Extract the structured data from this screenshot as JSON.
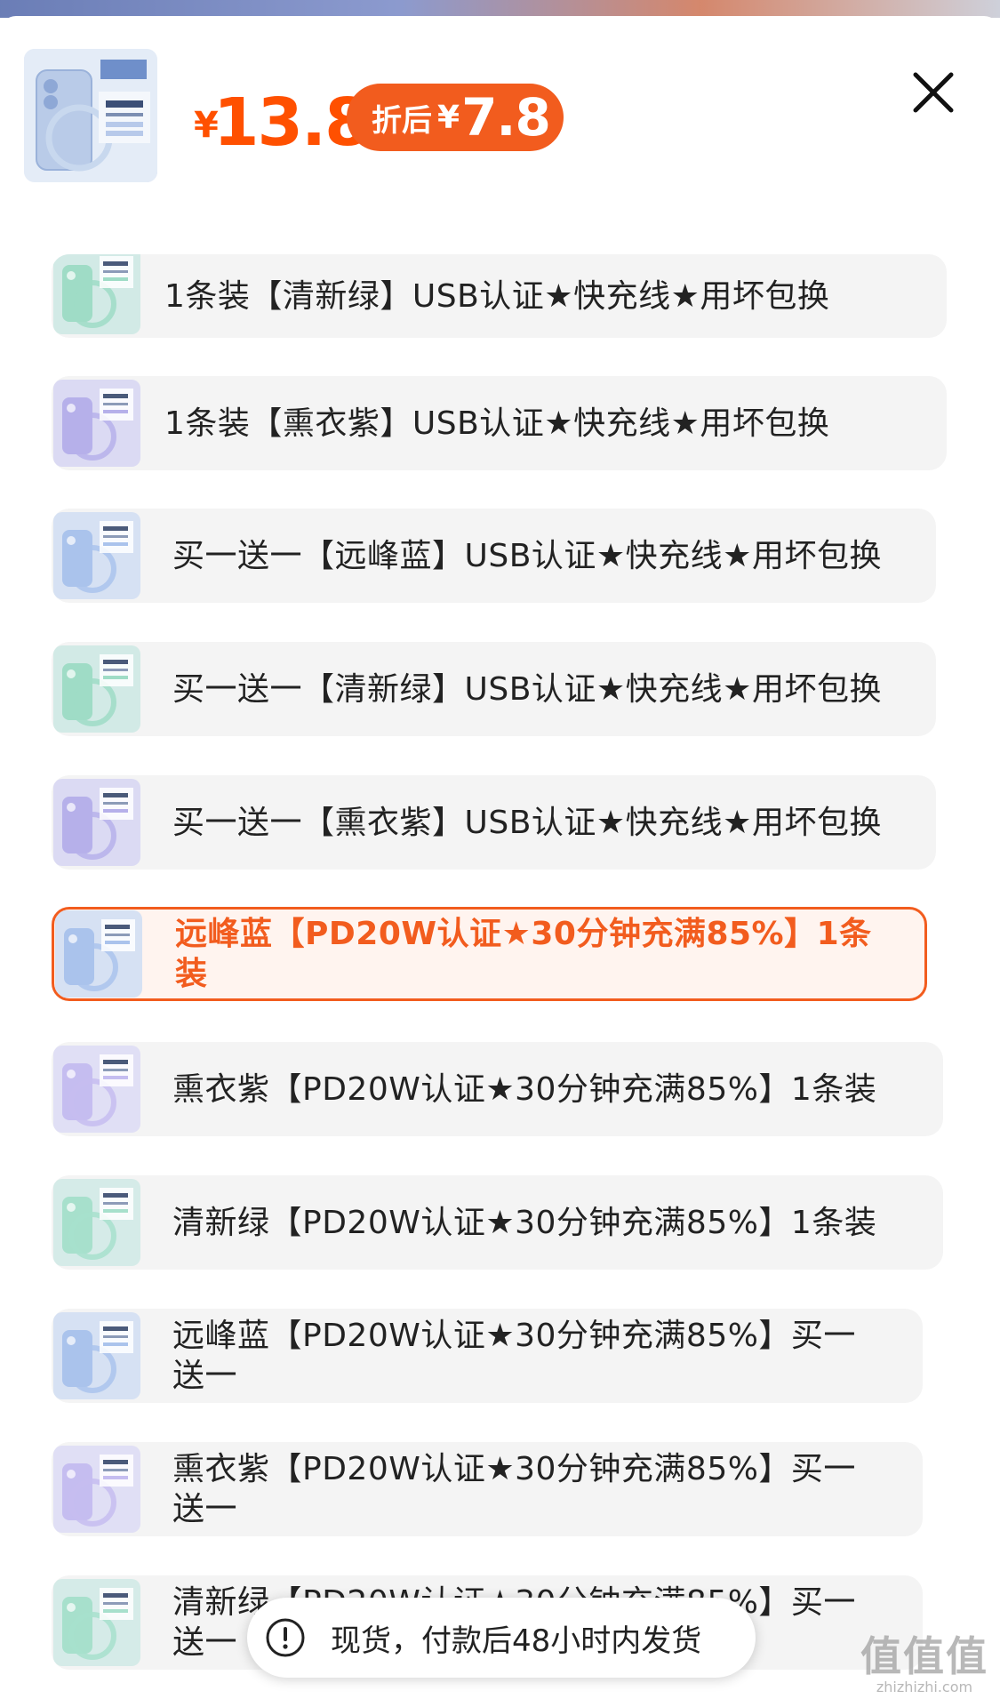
{
  "header": {
    "currency_symbol": "¥",
    "price": "13.8",
    "discount_label": "折后",
    "discount_currency": "¥",
    "discount_price": "7.8",
    "close_icon": "close-icon"
  },
  "options": [
    {
      "label": "1条装【清新绿】USB认证★快充线★用坏包换",
      "thumb_color": "#9fdcc6",
      "selected": false
    },
    {
      "label": "1条装【熏衣紫】USB认证★快充线★用坏包换",
      "thumb_color": "#b6b0ea",
      "selected": false
    },
    {
      "label": "买一送一【远峰蓝】USB认证★快充线★用坏包换",
      "thumb_color": "#aac3ec",
      "selected": false
    },
    {
      "label": "买一送一【清新绿】USB认证★快充线★用坏包换",
      "thumb_color": "#9fdcc6",
      "selected": false
    },
    {
      "label": "买一送一【熏衣紫】USB认证★快充线★用坏包换",
      "thumb_color": "#b6b0ea",
      "selected": false
    },
    {
      "label": "远峰蓝【PD20W认证★30分钟充满85%】1条装",
      "thumb_color": "#aac3ec",
      "selected": true
    },
    {
      "label": "熏衣紫【PD20W认证★30分钟充满85%】1条装",
      "thumb_color": "#c5bdf0",
      "selected": false
    },
    {
      "label": "清新绿【PD20W认证★30分钟充满85%】1条装",
      "thumb_color": "#a7e0cc",
      "selected": false
    },
    {
      "label": "远峰蓝【PD20W认证★30分钟充满85%】买一送一",
      "thumb_color": "#aac3ec",
      "selected": false
    },
    {
      "label": "熏衣紫【PD20W认证★30分钟充满85%】买一送一",
      "thumb_color": "#c5bdf0",
      "selected": false
    },
    {
      "label": "清新绿【PD20W认证★30分钟充满85%】买一送一",
      "thumb_color": "#a7e0cc",
      "selected": false
    }
  ],
  "toast": {
    "icon": "exclamation-circle-icon",
    "text": "现货，付款后48小时内发货"
  },
  "watermark": {
    "logo": "值值值",
    "url": "zhizhizhi.com"
  },
  "colors": {
    "accent": "#f25c1e",
    "price": "#ff5000",
    "option_bg": "#f4f4f4"
  }
}
